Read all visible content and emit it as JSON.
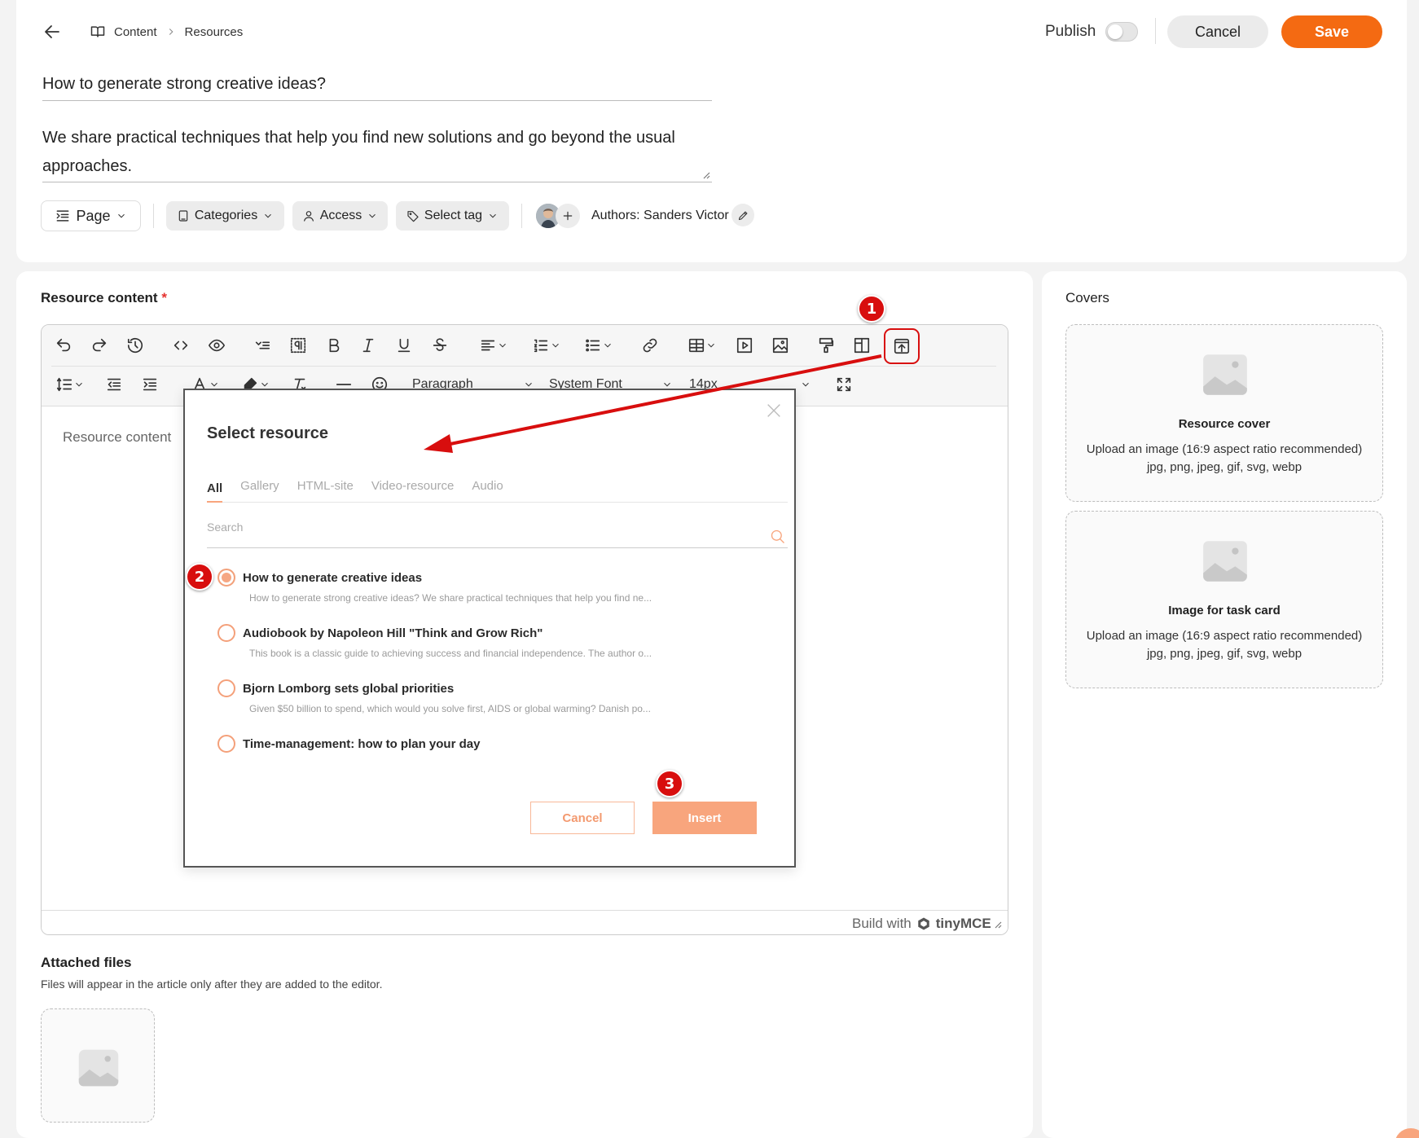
{
  "header": {
    "breadcrumb": [
      "Content",
      "Resources"
    ],
    "publish_label": "Publish",
    "publish_on": false,
    "cancel_label": "Cancel",
    "save_label": "Save"
  },
  "resource": {
    "title": "How to generate strong creative ideas?",
    "description_line1": "We share practical techniques that help you find new solutions and go beyond the usual",
    "description_line2": "approaches."
  },
  "meta_bar": {
    "page_label": "Page",
    "categories_label": "Categories",
    "access_label": "Access",
    "tag_label": "Select tag",
    "authors_label": "Authors: Sanders Victor"
  },
  "editor": {
    "label": "Resource content",
    "required_mark": "*",
    "placeholder": "Resource content",
    "paragraph_select": "Paragraph",
    "font_select": "System Font",
    "size_select": "14px",
    "footer_text": "Build with",
    "brand": "tinyMCE"
  },
  "modal": {
    "title": "Select resource",
    "tabs": [
      "All",
      "Gallery",
      "HTML-site",
      "Video-resource",
      "Audio"
    ],
    "active_tab": "All",
    "search_placeholder": "Search",
    "items": [
      {
        "title": "How to generate creative ideas",
        "desc": "How to generate strong creative ideas? We share practical techniques that help you find ne...",
        "selected": true
      },
      {
        "title": "Audiobook by Napoleon Hill \"Think and Grow Rich\"",
        "desc": "This book is a classic guide to achieving success and financial independence. The author o...",
        "selected": false
      },
      {
        "title": "Bjorn Lomborg sets global priorities",
        "desc": "Given $50 billion to spend, which would you solve first, AIDS or global warming? Danish po...",
        "selected": false
      },
      {
        "title": "Time-management: how to plan your day",
        "desc": "",
        "selected": false
      }
    ],
    "cancel_label": "Cancel",
    "insert_label": "Insert"
  },
  "annotations": [
    "1",
    "2",
    "3"
  ],
  "covers": {
    "label": "Covers",
    "resource_cover_title": "Resource cover",
    "task_card_title": "Image for task card",
    "hint_line1": "Upload an image (16:9 aspect ratio recommended)",
    "hint_line2": "jpg, png, jpeg, gif, svg, webp"
  },
  "attached": {
    "title": "Attached files",
    "hint": "Files will appear in the article only after they are added to the editor."
  },
  "colors": {
    "accent": "#f46a12",
    "accent_light": "#f8a57d",
    "annotation_red": "#d80e0e"
  }
}
